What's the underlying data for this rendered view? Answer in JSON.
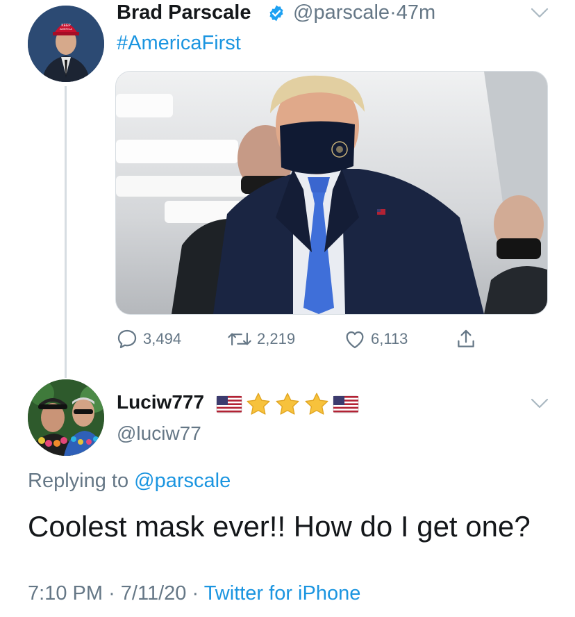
{
  "parent_tweet": {
    "display_name": "Brad Parscale",
    "handle": "@parscale",
    "separator": "·",
    "time_ago": "47m",
    "text": "#AmericaFirst",
    "stats": {
      "replies": "3,494",
      "retweets": "2,219",
      "likes": "6,113"
    },
    "avatar_icon": "user-avatar",
    "verified_icon": "verified-badge-icon"
  },
  "reply_tweet": {
    "display_name": "Luciw777",
    "name_emojis": [
      "us-flag",
      "star",
      "star",
      "star",
      "us-flag"
    ],
    "handle": "@luciw77",
    "replying_prefix": "Replying to",
    "replying_to": "@parscale",
    "text": "Coolest mask ever!! How do I get one?",
    "time": "7:10 PM",
    "separator": "·",
    "date": "7/11/20",
    "separator2": "·",
    "source": "Twitter for iPhone"
  },
  "colors": {
    "link": "#1b95e0",
    "secondary": "#657786",
    "verified": "#1da1f2",
    "thread_line": "#d7dde2"
  }
}
